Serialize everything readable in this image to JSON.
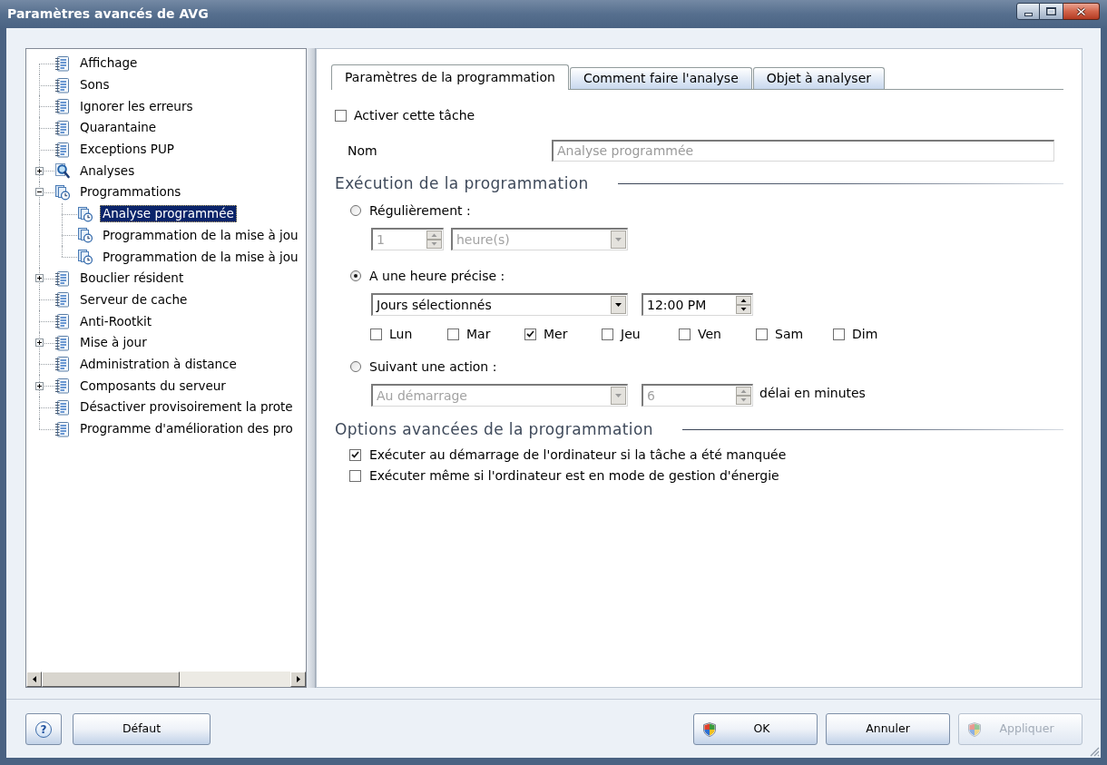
{
  "window": {
    "title": "Paramètres avancés de AVG"
  },
  "tree": {
    "items": [
      {
        "label": "Affichage",
        "kind": "settings",
        "selected": false
      },
      {
        "label": "Sons",
        "kind": "settings",
        "selected": false
      },
      {
        "label": "Ignorer les erreurs",
        "kind": "settings",
        "selected": false
      },
      {
        "label": "Quarantaine",
        "kind": "settings",
        "selected": false
      },
      {
        "label": "Exceptions PUP",
        "kind": "settings",
        "selected": false
      },
      {
        "label": "Analyses",
        "kind": "scan",
        "selected": false,
        "expanded": false
      },
      {
        "label": "Programmations",
        "kind": "schedule",
        "selected": false,
        "expanded": true,
        "children": [
          {
            "label": "Analyse programmée",
            "kind": "schedule",
            "selected": true
          },
          {
            "label": "Programmation de la mise à jou",
            "kind": "schedule",
            "selected": false
          },
          {
            "label": "Programmation de la mise à jou",
            "kind": "schedule",
            "selected": false
          }
        ]
      },
      {
        "label": "Bouclier résident",
        "kind": "settings",
        "selected": false,
        "expanded": false
      },
      {
        "label": "Serveur de cache",
        "kind": "settings",
        "selected": false
      },
      {
        "label": "Anti-Rootkit",
        "kind": "settings",
        "selected": false
      },
      {
        "label": "Mise à jour",
        "kind": "settings",
        "selected": false,
        "expanded": false
      },
      {
        "label": "Administration à distance",
        "kind": "settings",
        "selected": false
      },
      {
        "label": "Composants du serveur",
        "kind": "settings",
        "selected": false,
        "expanded": false
      },
      {
        "label": "Désactiver provisoirement la prote",
        "kind": "settings",
        "selected": false
      },
      {
        "label": "Programme d'amélioration des pro",
        "kind": "settings",
        "selected": false
      }
    ]
  },
  "tabs": [
    {
      "label": "Paramètres de la programmation",
      "selected": true
    },
    {
      "label": "Comment faire l'analyse",
      "selected": false
    },
    {
      "label": "Objet à analyser",
      "selected": false
    }
  ],
  "enable_task": {
    "label": "Activer cette tâche",
    "checked": false
  },
  "name_field": {
    "label": "Nom",
    "value": "Analyse programmée",
    "disabled": true
  },
  "execution": {
    "title": "Exécution de la programmation",
    "modes": [
      {
        "label": "Régulièrement :",
        "selected": false,
        "controls": [
          {
            "kind": "spin",
            "value": "1",
            "disabled": true
          },
          {
            "kind": "dropdown",
            "value": "heure(s)",
            "disabled": true
          }
        ]
      },
      {
        "label": "A une heure précise :",
        "selected": true,
        "controls": [
          {
            "kind": "dropdown",
            "value": "Jours sélectionnés",
            "disabled": false
          },
          {
            "kind": "spin",
            "value": "12:00 PM",
            "disabled": false
          }
        ],
        "days": [
          {
            "label": "Lun",
            "checked": false
          },
          {
            "label": "Mar",
            "checked": false
          },
          {
            "label": "Mer",
            "checked": true
          },
          {
            "label": "Jeu",
            "checked": false
          },
          {
            "label": "Ven",
            "checked": false
          },
          {
            "label": "Sam",
            "checked": false
          },
          {
            "label": "Dim",
            "checked": false
          }
        ]
      },
      {
        "label": "Suivant une action :",
        "selected": false,
        "controls": [
          {
            "kind": "dropdown",
            "value": "Au démarrage",
            "disabled": true
          },
          {
            "kind": "spin",
            "value": "6",
            "disabled": true
          }
        ],
        "suffix": "délai en minutes"
      }
    ]
  },
  "advanced": {
    "title": "Options avancées de la programmation",
    "options": [
      {
        "label": "Exécuter au démarrage de l'ordinateur si la tâche a été manquée",
        "checked": true
      },
      {
        "label": "Exécuter même si l'ordinateur est en mode de gestion d'énergie",
        "checked": false
      }
    ]
  },
  "footer": {
    "help_button": {
      "label": "?"
    },
    "left_buttons": [
      {
        "label": "Défaut",
        "disabled": false
      }
    ],
    "right_buttons": [
      {
        "label": "OK",
        "kind": "elevated",
        "disabled": false
      },
      {
        "label": "Annuler",
        "kind": "plain",
        "disabled": false
      },
      {
        "label": "Appliquer",
        "kind": "elevated",
        "disabled": true
      }
    ]
  }
}
